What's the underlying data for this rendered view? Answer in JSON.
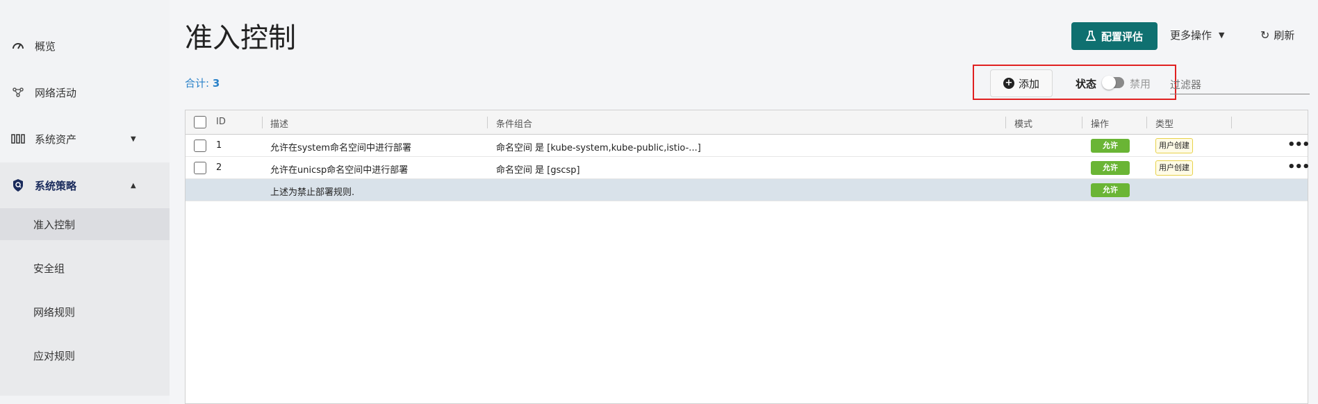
{
  "sidebar": {
    "items": [
      {
        "label": "概览",
        "icon": "gauge-icon"
      },
      {
        "label": "网络活动",
        "icon": "network-activity-icon"
      },
      {
        "label": "系统资产",
        "icon": "assets-icon"
      },
      {
        "label": "系统策略",
        "icon": "shield-policy-icon"
      }
    ],
    "subitems": [
      "准入控制",
      "安全组",
      "网络规则",
      "应对规则"
    ]
  },
  "header": {
    "title": "准入控制",
    "config_eval_label": "配置评估",
    "more_actions_label": "更多操作",
    "refresh_label": "刷新"
  },
  "toolbar": {
    "total_label": "合计:",
    "total_count": "3",
    "add_label": "添加",
    "status_label": "状态",
    "toggle_text": "禁用",
    "filter_placeholder": "过滤器"
  },
  "table": {
    "headers": [
      "ID",
      "描述",
      "条件组合",
      "模式",
      "操作",
      "类型"
    ],
    "rows": [
      {
        "id": "1",
        "desc": "允许在system命名空间中进行部署",
        "cond": "命名空间 是 [kube-system,kube-public,istio-...]",
        "mode": "",
        "action": "允许",
        "type": "用户创建"
      },
      {
        "id": "2",
        "desc": "允许在unicsp命名空间中进行部署",
        "cond": "命名空间 是 [gscsp]",
        "mode": "",
        "action": "允许",
        "type": "用户创建"
      }
    ],
    "note_row": {
      "desc": "上述为禁止部署规则.",
      "action": "允许"
    }
  },
  "colors": {
    "primary": "#0f7070",
    "allow": "#6ab535",
    "highlight": "#e02020",
    "link": "#2a82c9"
  }
}
